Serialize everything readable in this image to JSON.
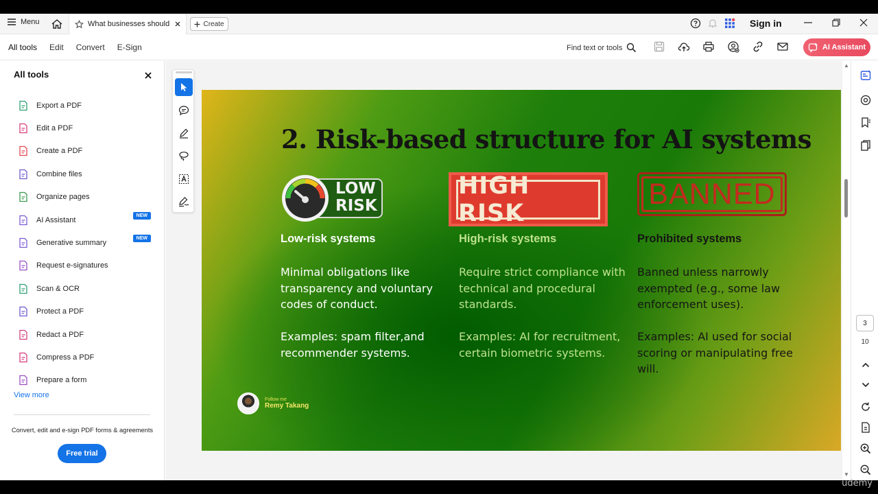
{
  "titlebar": {
    "menu_label": "Menu",
    "tab_title": "What businesses should ...",
    "create_label": "Create",
    "sign_in": "Sign in"
  },
  "menubar": {
    "tabs": [
      "All tools",
      "Edit",
      "Convert",
      "E-Sign"
    ],
    "find_text": "Find text or tools",
    "ai_assistant": "AI Assistant"
  },
  "left_panel": {
    "title": "All tools",
    "tools": [
      {
        "label": "Export a PDF",
        "icon": "export-pdf-icon",
        "color": "#2f9f74"
      },
      {
        "label": "Edit a PDF",
        "icon": "edit-pdf-icon",
        "color": "#d63f7c"
      },
      {
        "label": "Create a PDF",
        "icon": "create-pdf-icon",
        "color": "#e34850"
      },
      {
        "label": "Combine files",
        "icon": "combine-files-icon",
        "color": "#6d5bd0"
      },
      {
        "label": "Organize pages",
        "icon": "organize-pages-icon",
        "color": "#3a9a52"
      },
      {
        "label": "AI Assistant",
        "icon": "ai-assistant-icon",
        "color": "#7b5bd6",
        "badge": "NEW"
      },
      {
        "label": "Generative summary",
        "icon": "generative-summary-icon",
        "color": "#7b5bd6",
        "badge": "NEW"
      },
      {
        "label": "Request e-signatures",
        "icon": "request-esignatures-icon",
        "color": "#9b4fc4"
      },
      {
        "label": "Scan & OCR",
        "icon": "scan-ocr-icon",
        "color": "#2f9f74"
      },
      {
        "label": "Protect a PDF",
        "icon": "protect-pdf-icon",
        "color": "#6d5bd0"
      },
      {
        "label": "Redact a PDF",
        "icon": "redact-pdf-icon",
        "color": "#d63f7c"
      },
      {
        "label": "Compress a PDF",
        "icon": "compress-pdf-icon",
        "color": "#d63f7c"
      },
      {
        "label": "Prepare a form",
        "icon": "prepare-form-icon",
        "color": "#9b4fc4"
      }
    ],
    "view_more": "View more",
    "promo": "Convert, edit and e-sign PDF forms & agreements",
    "free_trial": "Free trial"
  },
  "slide": {
    "title": "2. Risk-based structure for AI systems",
    "columns": [
      {
        "badge_line1": "LOW",
        "badge_line2": "RISK",
        "heading": "Low-risk systems",
        "body": "Minimal obligations like transparency and voluntary codes of conduct.",
        "examples": "Examples: spam filter,and recommender systems.",
        "color": "#ffffff"
      },
      {
        "badge": "HIGH RISK",
        "heading": "High-risk systems",
        "body": "Require strict compliance with technical and procedural standards.",
        "examples": "Examples: AI for recruitment, certain biometric systems.",
        "color": "#bfe28f"
      },
      {
        "badge": "BANNED",
        "heading": "Prohibited systems",
        "body": "Banned unless narrowly exempted (e.g., some law enforcement uses).",
        "examples": "Examples: AI used for social scoring or manipulating free will.",
        "color": "#151515"
      }
    ],
    "follow_label": "Follow me",
    "author": "Remy Takang"
  },
  "pagination": {
    "current": "3",
    "total": "10"
  },
  "watermark": "udemy"
}
